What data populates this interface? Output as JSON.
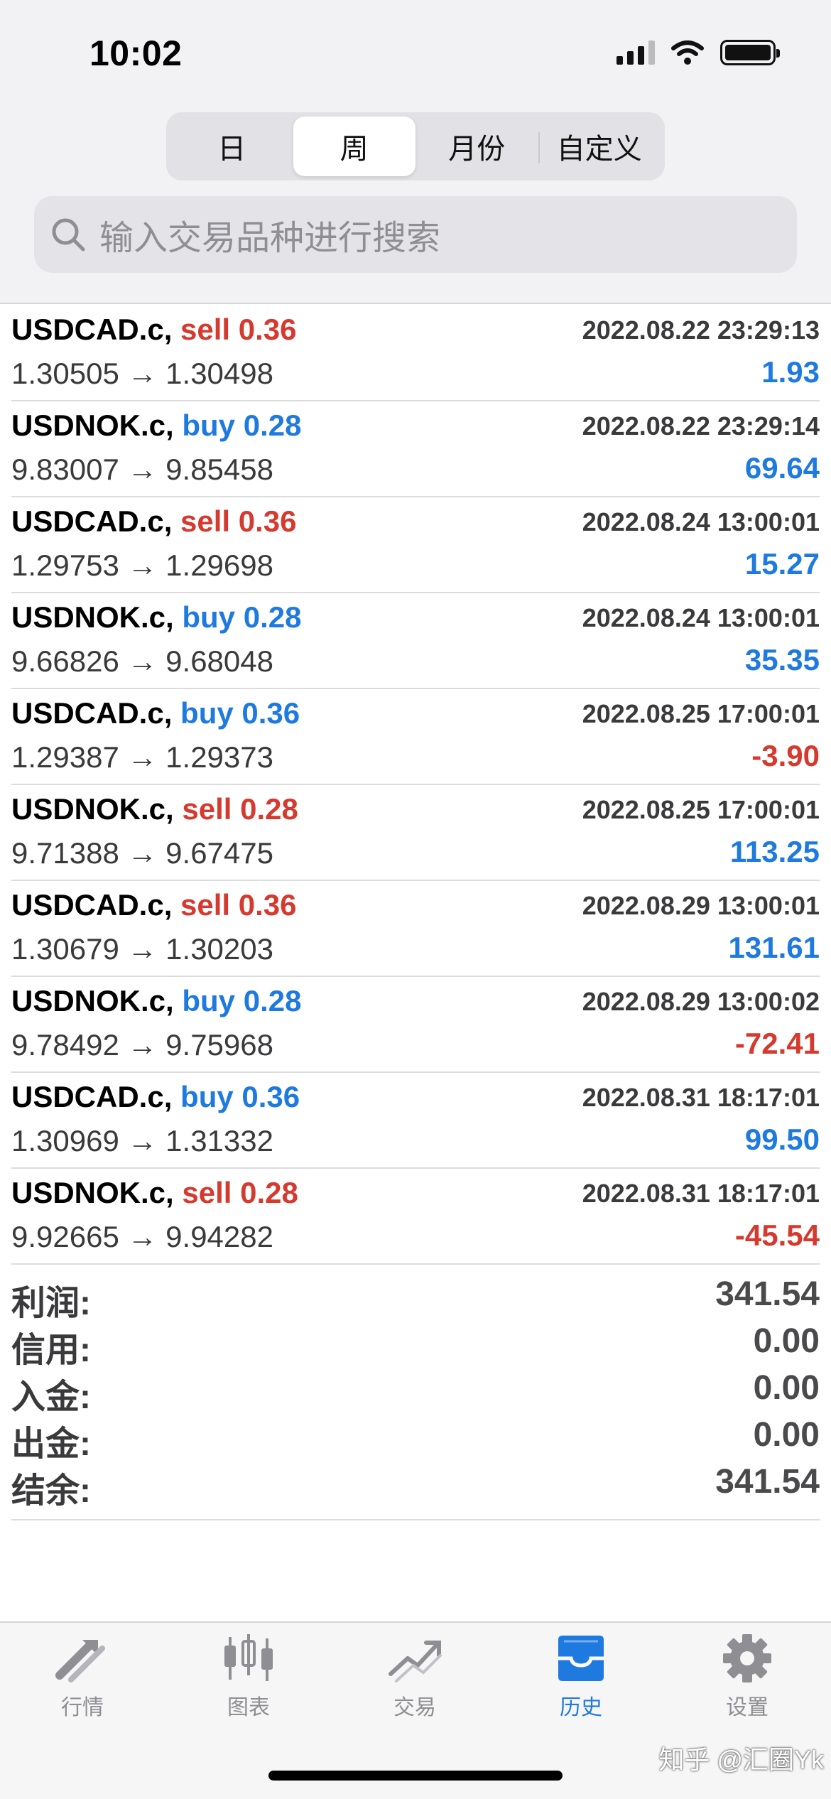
{
  "status_bar": {
    "time": "10:02"
  },
  "segments": [
    {
      "label": "日",
      "active": false
    },
    {
      "label": "周",
      "active": true
    },
    {
      "label": "月份",
      "active": false
    },
    {
      "label": "自定义",
      "active": false
    }
  ],
  "search": {
    "placeholder": "输入交易品种进行搜索"
  },
  "trades": [
    {
      "symbol": "USDCAD.c,",
      "side": "sell",
      "volume": "0.36",
      "time": "2022.08.22 23:29:13",
      "open": "1.30505",
      "close": "1.30498",
      "profit": "1.93",
      "profit_sign": "pos"
    },
    {
      "symbol": "USDNOK.c,",
      "side": "buy",
      "volume": "0.28",
      "time": "2022.08.22 23:29:14",
      "open": "9.83007",
      "close": "9.85458",
      "profit": "69.64",
      "profit_sign": "pos"
    },
    {
      "symbol": "USDCAD.c,",
      "side": "sell",
      "volume": "0.36",
      "time": "2022.08.24 13:00:01",
      "open": "1.29753",
      "close": "1.29698",
      "profit": "15.27",
      "profit_sign": "pos"
    },
    {
      "symbol": "USDNOK.c,",
      "side": "buy",
      "volume": "0.28",
      "time": "2022.08.24 13:00:01",
      "open": "9.66826",
      "close": "9.68048",
      "profit": "35.35",
      "profit_sign": "pos"
    },
    {
      "symbol": "USDCAD.c,",
      "side": "buy",
      "volume": "0.36",
      "time": "2022.08.25 17:00:01",
      "open": "1.29387",
      "close": "1.29373",
      "profit": "-3.90",
      "profit_sign": "neg"
    },
    {
      "symbol": "USDNOK.c,",
      "side": "sell",
      "volume": "0.28",
      "time": "2022.08.25 17:00:01",
      "open": "9.71388",
      "close": "9.67475",
      "profit": "113.25",
      "profit_sign": "pos"
    },
    {
      "symbol": "USDCAD.c,",
      "side": "sell",
      "volume": "0.36",
      "time": "2022.08.29 13:00:01",
      "open": "1.30679",
      "close": "1.30203",
      "profit": "131.61",
      "profit_sign": "pos"
    },
    {
      "symbol": "USDNOK.c,",
      "side": "buy",
      "volume": "0.28",
      "time": "2022.08.29 13:00:02",
      "open": "9.78492",
      "close": "9.75968",
      "profit": "-72.41",
      "profit_sign": "neg"
    },
    {
      "symbol": "USDCAD.c,",
      "side": "buy",
      "volume": "0.36",
      "time": "2022.08.31 18:17:01",
      "open": "1.30969",
      "close": "1.31332",
      "profit": "99.50",
      "profit_sign": "pos"
    },
    {
      "symbol": "USDNOK.c,",
      "side": "sell",
      "volume": "0.28",
      "time": "2022.08.31 18:17:01",
      "open": "9.92665",
      "close": "9.94282",
      "profit": "-45.54",
      "profit_sign": "neg"
    }
  ],
  "arrow": "→",
  "summary": [
    {
      "label": "利润:",
      "value": "341.54"
    },
    {
      "label": "信用:",
      "value": "0.00"
    },
    {
      "label": "入金:",
      "value": "0.00"
    },
    {
      "label": "出金:",
      "value": "0.00"
    },
    {
      "label": "结余:",
      "value": "341.54"
    }
  ],
  "tabbar": [
    {
      "label": "行情",
      "icon": "quotes-icon",
      "active": false
    },
    {
      "label": "图表",
      "icon": "chart-icon",
      "active": false
    },
    {
      "label": "交易",
      "icon": "trade-icon",
      "active": false
    },
    {
      "label": "历史",
      "icon": "history-icon",
      "active": true
    },
    {
      "label": "设置",
      "icon": "settings-icon",
      "active": false
    }
  ],
  "watermark": "知乎 @汇圈Yk",
  "colors": {
    "buy": "#1f7ae0",
    "sell": "#d6392e",
    "active_tab": "#1f7ae0",
    "inactive_tab": "#8e8e93"
  }
}
